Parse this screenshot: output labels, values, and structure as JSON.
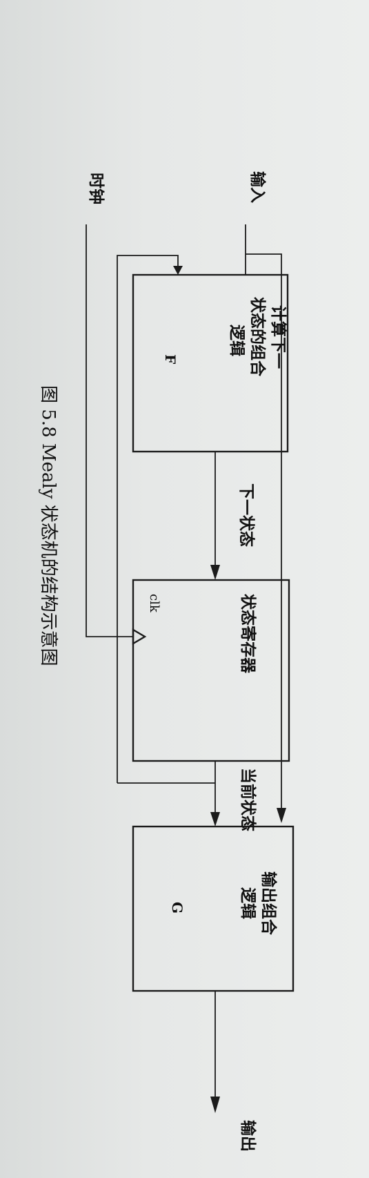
{
  "diagram": {
    "labels": {
      "input": "输入",
      "clock": "时钟",
      "output": "输出",
      "next_state": "下一状态",
      "current_state": "当前状态",
      "clk": "clk"
    },
    "blocks": {
      "next_state_logic": {
        "line1": "计算下一",
        "line2": "状态的组合",
        "line3": "逻辑",
        "tag": "F"
      },
      "state_register": {
        "line1": "状态寄存器"
      },
      "output_logic": {
        "line1": "输出组合",
        "line2": "逻辑",
        "tag": "G"
      }
    },
    "caption": "图 5.8   Mealy 状态机的结构示意图"
  }
}
